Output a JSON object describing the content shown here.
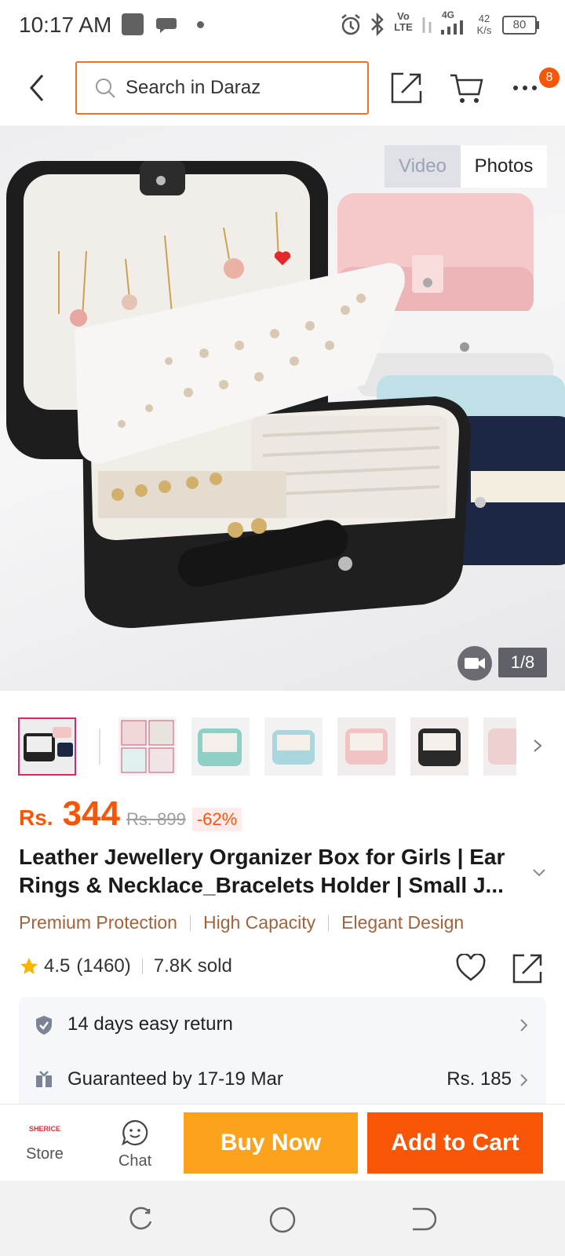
{
  "status_bar": {
    "time": "10:17 AM",
    "network_speed": "42",
    "network_unit": "K/s",
    "battery": "80",
    "signal_label_top": "Vo",
    "signal_label_bottom": "LTE",
    "network_type": "4G"
  },
  "header": {
    "search_placeholder": "Search in Daraz",
    "cart_badge_count": "8"
  },
  "gallery": {
    "video_tab": "Video",
    "photos_tab": "Photos",
    "page_indicator": "1/8"
  },
  "product": {
    "price_currency": "Rs.",
    "price": "344",
    "original_price": "Rs. 899",
    "discount": "-62%",
    "title": "Leather Jewellery Organizer Box for Girls | Ear Rings & Necklace_Bracelets Holder | Small J...",
    "tags": [
      "Premium Protection",
      "High Capacity",
      "Elegant Design"
    ],
    "rating": "4.5",
    "rating_count": "(1460)",
    "sold": "7.8K sold"
  },
  "services": [
    {
      "label": "14 days easy return",
      "icon": "shield-check-icon"
    },
    {
      "label": "Guaranteed by 17-19 Mar",
      "price": "Rs. 185",
      "icon": "gift-box-icon"
    }
  ],
  "actions": {
    "store_logo_text": "SHERICE",
    "store_label": "Store",
    "chat_label": "Chat",
    "buy_now": "Buy Now",
    "add_to_cart": "Add to Cart"
  },
  "colors": {
    "accent": "#f85606",
    "buy_now": "#fca21c",
    "tag_text": "#a0633d"
  }
}
